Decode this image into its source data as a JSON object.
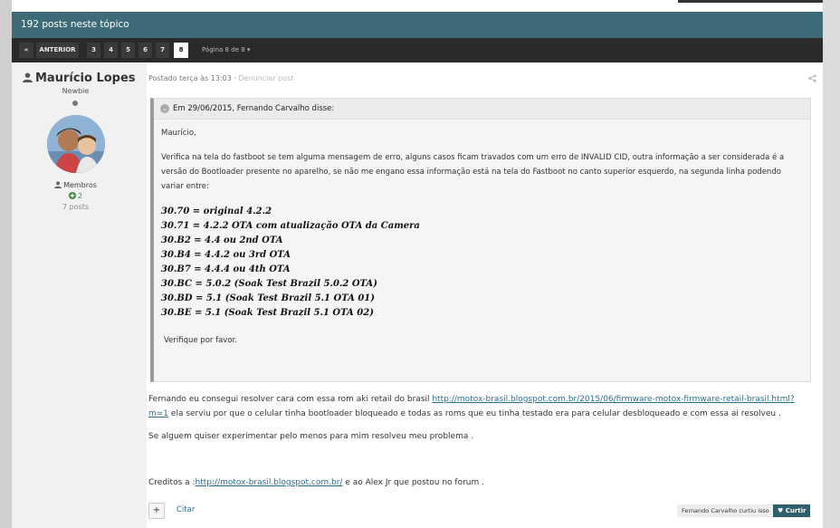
{
  "topic": {
    "posts_count": "192 posts neste tópico"
  },
  "pagination": {
    "first": "«",
    "prev": "ANTERIOR",
    "pages": [
      "3",
      "4",
      "5",
      "6",
      "7",
      "8"
    ],
    "current": "8",
    "info": "Página 8 de 8 ▾"
  },
  "author": {
    "name": "Maurício Lopes",
    "rank": "Newbie",
    "group": "Membros",
    "reputation": "2",
    "posts": "7 posts"
  },
  "post": {
    "posted": "Postado terça às 13:03",
    "separator": " · ",
    "report": "Denunciar post"
  },
  "quote": {
    "header": "Em 29/06/2015, Fernando Carvalho disse:",
    "greeting": "Maurício,",
    "paragraph": "Verifica na tela do fastboot se tem alguma mensagem de erro, alguns casos ficam travados com um erro de INVALID CID, outra informação a ser considerada é a versão do Bootloader presente no aparelho, se não me engano essa informação está na tela do Fastboot no canto superior esquerdo, na segunda linha podendo variar entre:",
    "versions": [
      "30.70 = original 4.2.2",
      "30.71 = 4.2.2 OTA com atualização OTA da Camera",
      "30.B2 = 4.4 ou 2nd OTA",
      "30.B4 = 4.4.2 ou 3rd OTA",
      "30.B7 = 4.4.4 ou 4th OTA",
      "30.BC = 5.0.2 (Soak Test Brazil 5.0.2 OTA)",
      "30.BD = 5.1 (Soak Test Brazil 5.1 OTA 01)",
      "30.BE = 5.1 (Soak Test Brazil 5.1 OTA 02)"
    ],
    "closing": "Verifique por favor."
  },
  "body": {
    "p1_a": "Fernando eu consegui resolver cara com essa rom aki retail do brasil ",
    "p1_link": "http://motox-brasil.blogspot.com.br/2015/06/firmware-motox-firmware-retail-brasil.html?m=1",
    "p1_b": " ela serviu por que o celular tinha bootloader bloqueado e todas as roms que eu tinha testado era para celular desbloqueado e com essa ai resolveu .",
    "p2": "Se alguem quiser experimentar pelo menos para mim resolveu meu problema .",
    "p3_a": "Creditos a :",
    "p3_link": "http://motox-brasil.blogspot.com.br/",
    "p3_b": " e ao Alex Jr que postou no forum ."
  },
  "actions": {
    "add": "+",
    "cite": "Citar",
    "liked_by": "Fernando Carvalho curtiu isso",
    "like": "♥ Curtir"
  },
  "colors": {
    "header": "#3d6b77",
    "pagination": "#2a2a2a",
    "link": "#2b6f8e",
    "like": "#2f5f6b"
  }
}
